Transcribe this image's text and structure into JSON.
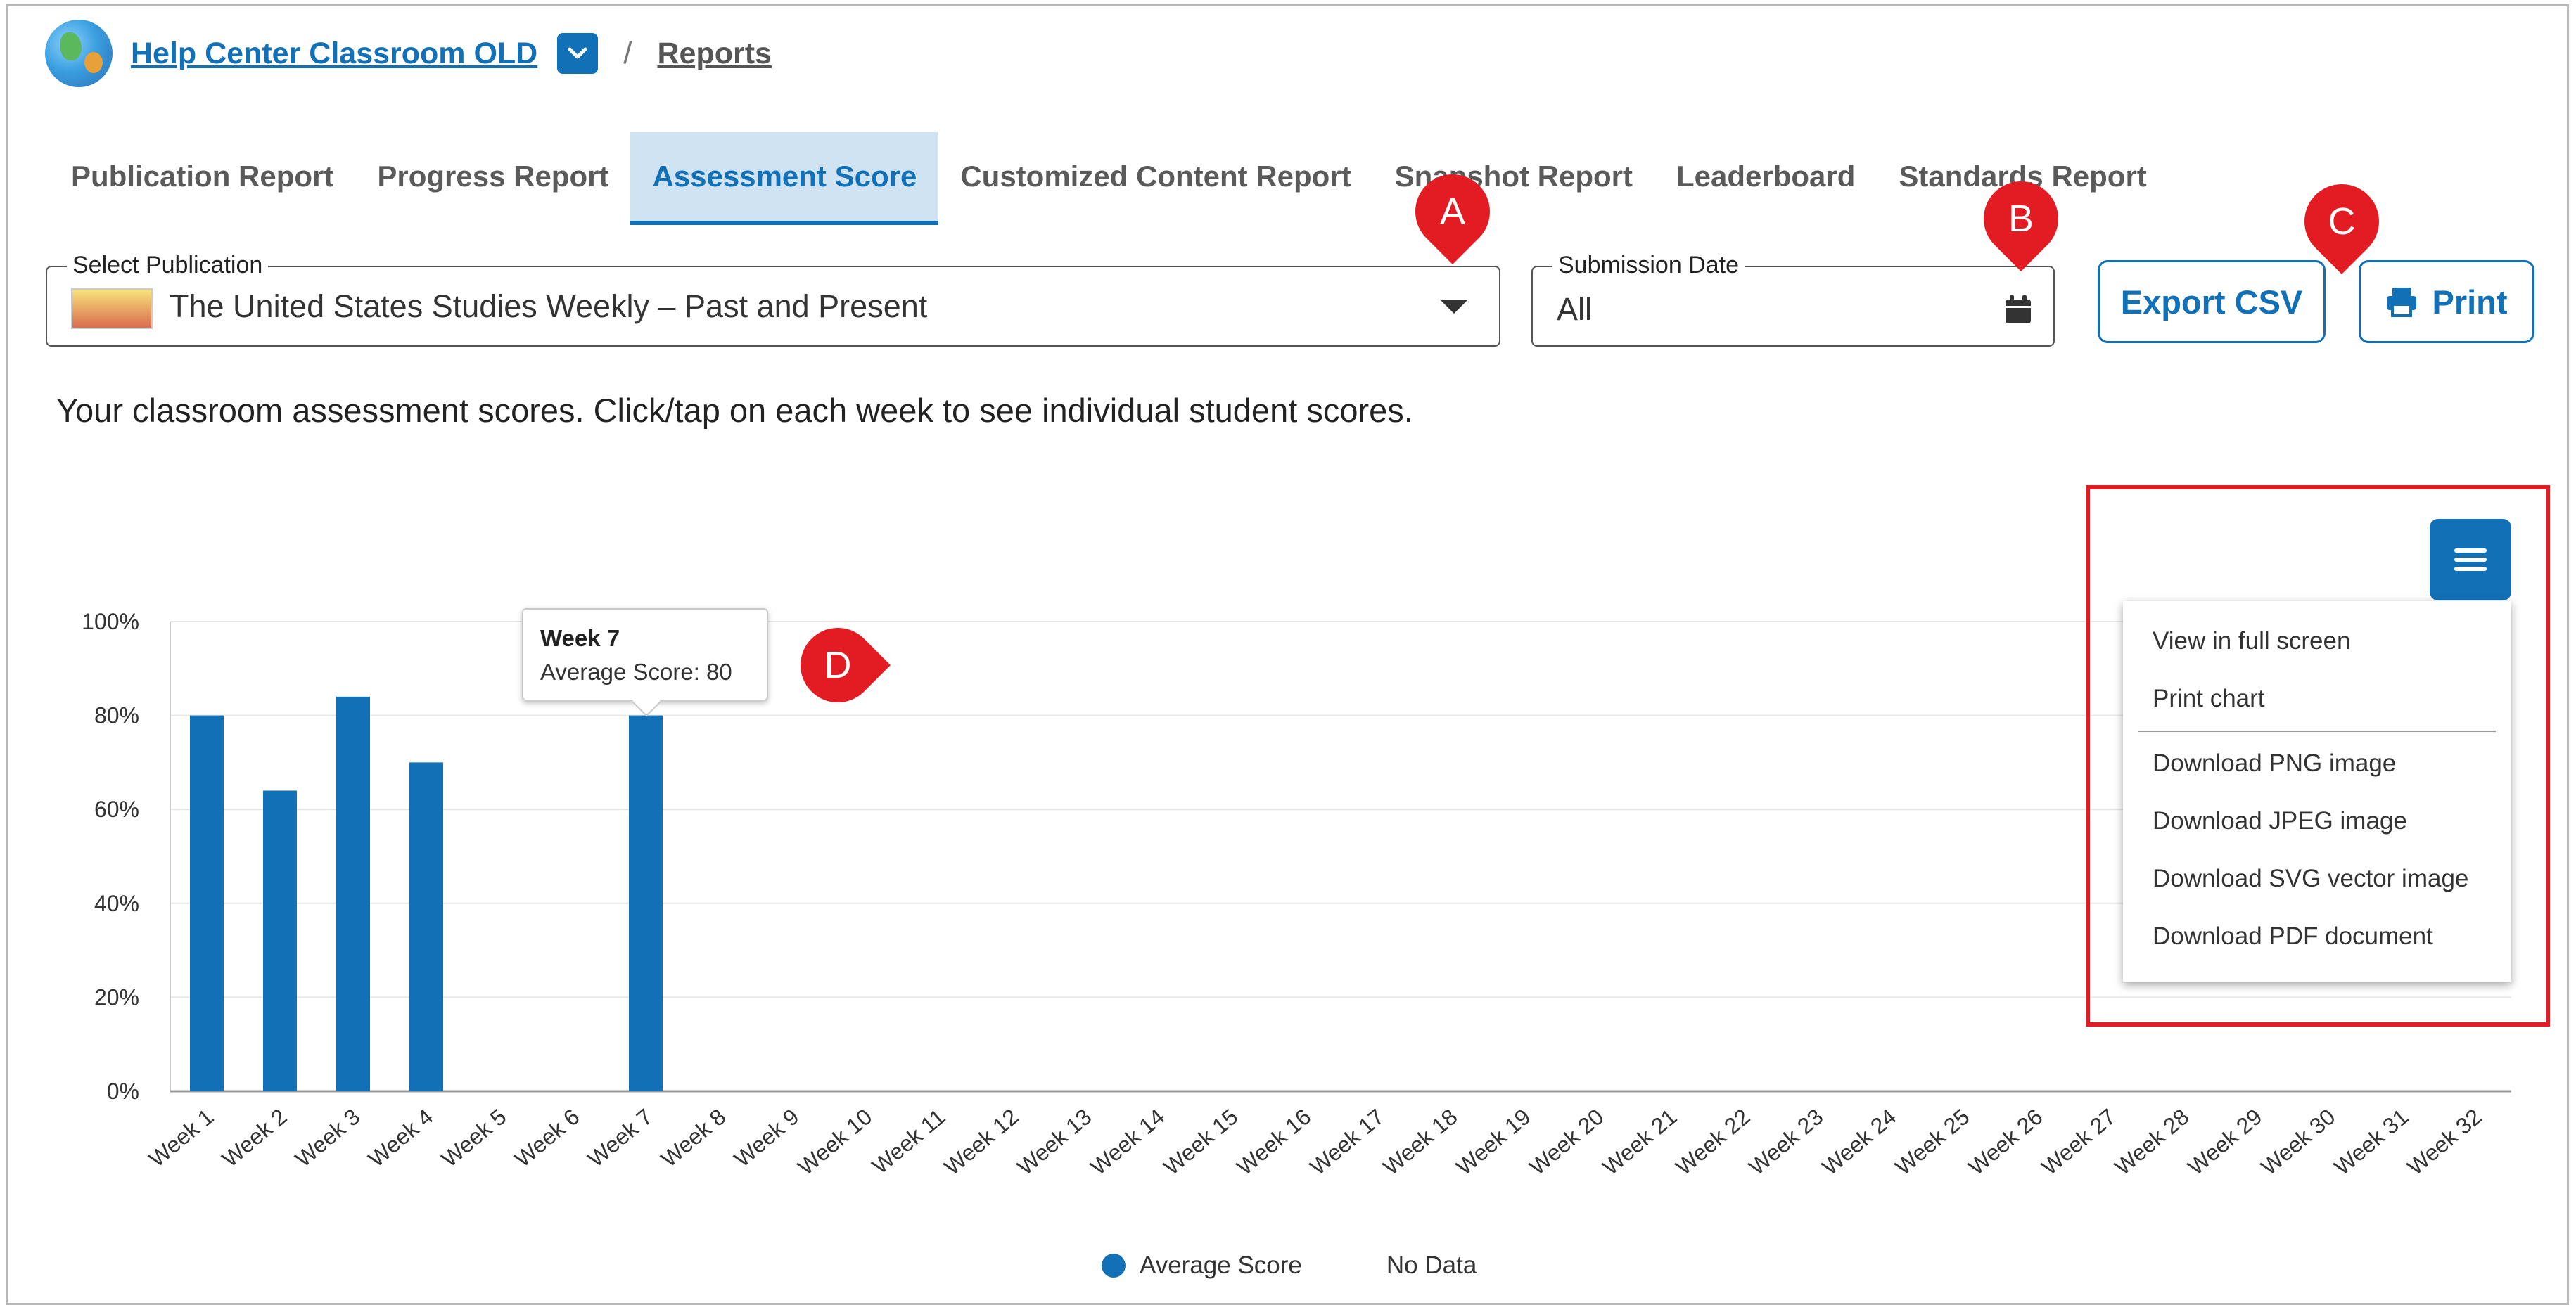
{
  "header": {
    "classroom_name": "Help Center Classroom OLD",
    "separator": "/",
    "breadcrumb": "Reports"
  },
  "tabs": [
    {
      "label": "Publication Report",
      "active": false
    },
    {
      "label": "Progress Report",
      "active": false
    },
    {
      "label": "Assessment Score",
      "active": true
    },
    {
      "label": "Customized Content Report",
      "active": false
    },
    {
      "label": "Snapshot Report",
      "active": false
    },
    {
      "label": "Leaderboard",
      "active": false
    },
    {
      "label": "Standards Report",
      "active": false
    }
  ],
  "filters": {
    "publication_label": "Select Publication",
    "publication_value": "The United States Studies Weekly – Past and Present",
    "date_label": "Submission Date",
    "date_value": "All"
  },
  "actions": {
    "export_label": "Export CSV",
    "print_label": "Print"
  },
  "instruction": "Your classroom assessment scores. Click/tap on each week to see individual student scores.",
  "markers": {
    "a": "A",
    "b": "B",
    "c": "C",
    "d": "D"
  },
  "tooltip": {
    "title": "Week 7",
    "line": "Average Score: 80"
  },
  "export_menu": {
    "items": [
      "View in full screen",
      "Print chart",
      "Download PNG image",
      "Download JPEG image",
      "Download SVG vector image",
      "Download PDF document"
    ]
  },
  "legend": {
    "series": "Average Score",
    "no_data": "No Data"
  },
  "colors": {
    "accent": "#1270b7",
    "highlight": "#e31b23",
    "active_tab_bg": "#cfe3f3"
  },
  "chart_data": {
    "type": "bar",
    "categories": [
      "Week 1",
      "Week 2",
      "Week 3",
      "Week 4",
      "Week 5",
      "Week 6",
      "Week 7",
      "Week 8",
      "Week 9",
      "Week 10",
      "Week 11",
      "Week 12",
      "Week 13",
      "Week 14",
      "Week 15",
      "Week 16",
      "Week 17",
      "Week 18",
      "Week 19",
      "Week 20",
      "Week 21",
      "Week 22",
      "Week 23",
      "Week 24",
      "Week 25",
      "Week 26",
      "Week 27",
      "Week 28",
      "Week 29",
      "Week 30",
      "Week 31",
      "Week 32"
    ],
    "series": [
      {
        "name": "Average Score",
        "values": [
          80,
          64,
          84,
          70,
          null,
          null,
          80,
          null,
          null,
          null,
          null,
          null,
          null,
          null,
          null,
          null,
          null,
          null,
          null,
          null,
          null,
          null,
          null,
          null,
          null,
          null,
          null,
          null,
          null,
          null,
          null,
          null
        ]
      }
    ],
    "y_ticks": [
      "0%",
      "20%",
      "40%",
      "60%",
      "80%",
      "100%"
    ],
    "ylim": [
      0,
      100
    ],
    "grid": true,
    "legend_position": "bottom"
  }
}
